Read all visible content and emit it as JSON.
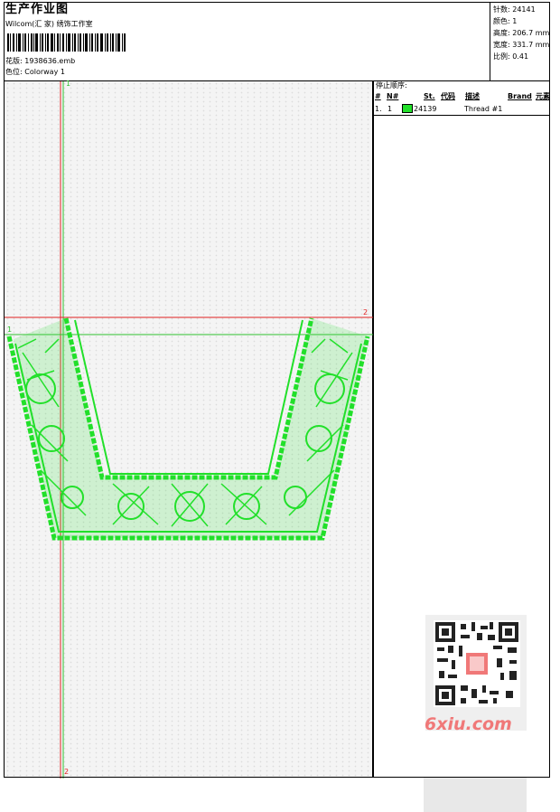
{
  "header": {
    "title": "生产作业图",
    "company": "Wilcom(汇 家) 绣饰工作室",
    "design_file_label": "花版:",
    "design_file_value": "1938636.emb",
    "colorway_label": "色位:",
    "colorway_value": "Colorway 1"
  },
  "stats": [
    {
      "label": "针数:",
      "value": "24141"
    },
    {
      "label": "颜色:",
      "value": "1"
    },
    {
      "label": "高度:",
      "value": "206.7 mm"
    },
    {
      "label": "宽度:",
      "value": "331.7 mm"
    },
    {
      "label": "比例:",
      "value": "0.41"
    }
  ],
  "stop_sequence": {
    "title": "停止顺序:",
    "columns": [
      "#",
      "N#",
      "St.",
      "代码",
      "描述",
      "Brand",
      "元素"
    ],
    "rows": [
      {
        "index": "1.",
        "needle": "1",
        "code": "24139",
        "description": "Thread #1",
        "color": "#22e02a"
      }
    ]
  },
  "guides": {
    "vertical_top_label": "1",
    "vertical_bottom_label": "2",
    "horizontal_left_label": "1",
    "horizontal_right_label": "2"
  },
  "watermark": {
    "text": "6xiu.com",
    "icon": "qr-code-icon"
  },
  "colors": {
    "embroidery": "#22e02a",
    "guide_red": "#e02020",
    "guide_green": "#30c030"
  }
}
